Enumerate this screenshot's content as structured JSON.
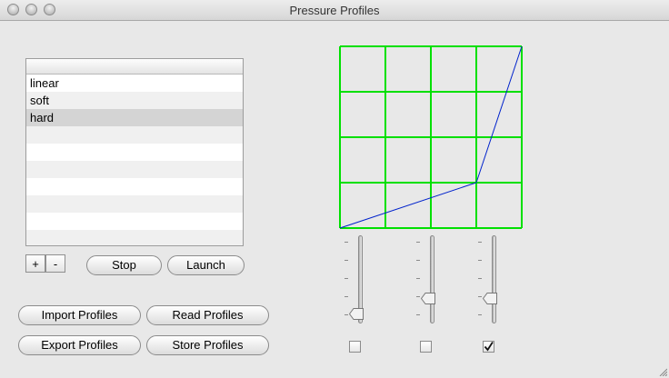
{
  "window": {
    "title": "Pressure Profiles"
  },
  "profiles": {
    "items": [
      "linear",
      "soft",
      "hard"
    ],
    "selected": "hard"
  },
  "list_controls": {
    "add": "+",
    "remove": "-"
  },
  "buttons": {
    "stop": "Stop",
    "launch": "Launch",
    "import": "Import Profiles",
    "read": "Read Profiles",
    "export": "Export Profiles",
    "store": "Store Profiles"
  },
  "curve": {
    "grid_color": "#00e000",
    "line_color": "#0022cc",
    "points": [
      [
        0,
        0
      ],
      [
        0.75,
        0.25
      ],
      [
        1,
        1
      ]
    ]
  },
  "sliders": {
    "levels": [
      0.05,
      0.27,
      0.27
    ],
    "checked": [
      false,
      false,
      true
    ]
  },
  "colors": {
    "window_bg": "#e8e8e8",
    "selected_row": "#d4d4d4"
  }
}
